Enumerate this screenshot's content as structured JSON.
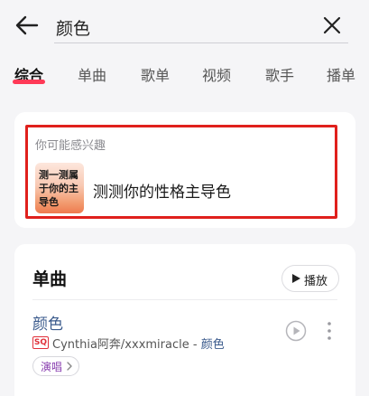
{
  "search": {
    "query": "颜色"
  },
  "tabs": [
    {
      "label": "综合",
      "active": true
    },
    {
      "label": "单曲"
    },
    {
      "label": "歌单"
    },
    {
      "label": "视频"
    },
    {
      "label": "歌手"
    },
    {
      "label": "播单"
    }
  ],
  "recommend": {
    "heading": "你可能感兴趣",
    "thumb_text": "测一测属于你的主导色",
    "title": "测测你的性格主导色"
  },
  "songs_section": {
    "title": "单曲",
    "play_all_label": "播放",
    "items": [
      {
        "title": "颜色",
        "quality_badge": "SQ",
        "artists": "Cynthia阿奔/xxxmiracle - ",
        "album": "颜色",
        "tag": "演唱"
      }
    ]
  },
  "colors": {
    "accent": "#ff3a57",
    "highlight_border": "#e0201c",
    "link": "#3a5a8c"
  }
}
